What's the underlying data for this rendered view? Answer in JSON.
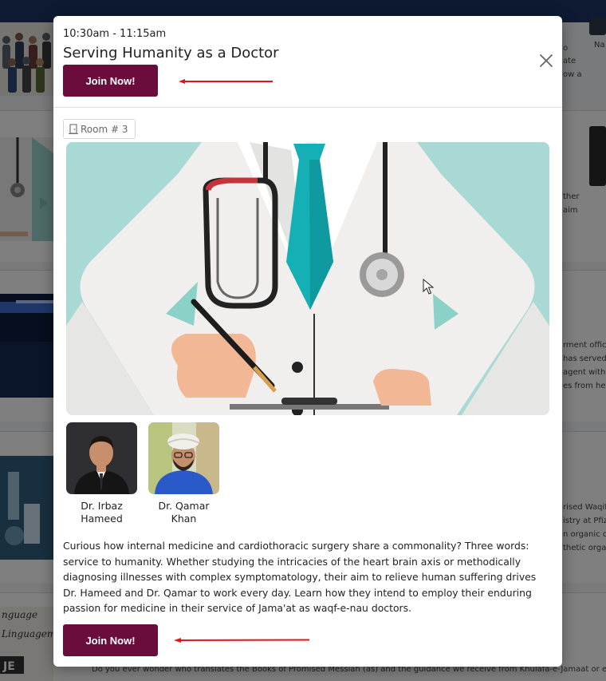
{
  "background": {
    "snippets": [
      "o",
      "ate",
      "ow a",
      "Na",
      "ther",
      "aim",
      "rment office",
      "has served",
      "agent with t",
      "es from hea",
      "rised Waqif",
      "istry at Pfiz",
      "n organic ch",
      "thetic orga",
      "Do you ever wonder who translates the Books of Promised Messiah (as) and the guidance we receive from Khulafa-e-Jamaat or eve"
    ]
  },
  "modal": {
    "time": "10:30am - 11:15am",
    "title": "Serving Humanity as a Doctor",
    "join_top_label": "Join Now!",
    "join_bottom_label": "Join Now!",
    "room": "Room # 3",
    "speakers": [
      {
        "name_line1": "Dr. Irbaz",
        "name_line2": "Hameed"
      },
      {
        "name_line1": "Dr. Qamar",
        "name_line2": "Khan"
      }
    ],
    "description": "Curious how internal medicine and cardiothoracic surgery share a commonality? Three words: service to humanity. Whether studying the intricacies of the heart brain axis or methodically diagnosing illnesses with complex symptomatology, their aim to relieve human suffering drives Dr. Hameed and Dr. Qamar to work every day. Learn how they intend to employ their enduring passion for medicine in their service of Jama'at as waqf-e-nau doctors."
  },
  "colors": {
    "join_button": "#6b0d3c",
    "annotation_arrow": "#e0141b",
    "hero_background": "#a9d9d4",
    "topbar": "#1b3563"
  },
  "icons": [
    "close-icon",
    "door-icon",
    "cursor-icon"
  ]
}
